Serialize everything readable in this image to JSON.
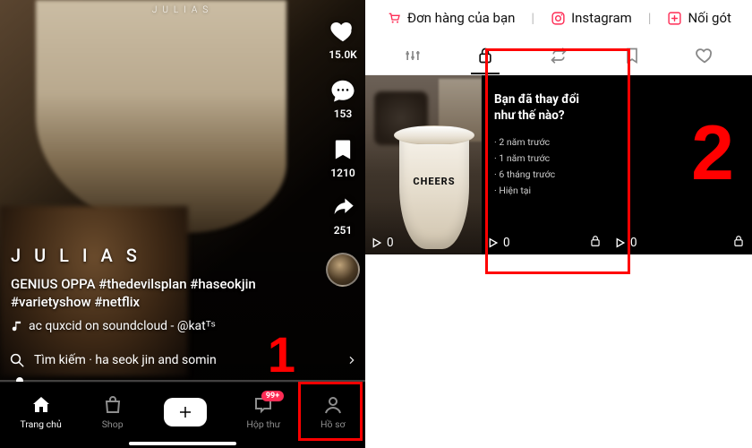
{
  "left": {
    "brand": "JULIAS",
    "rail": {
      "like_count": "15.0K",
      "comment_count": "153",
      "bookmark_count": "1210",
      "share_count": "251"
    },
    "username": "J U L I A S",
    "caption": "GENIUS OPPA #thedevilsplan #haseokjin #varietyshow #netflix",
    "sound": "ac quxcid on soundcloud - @katᵀˢ",
    "search_label": "Tìm kiếm · ha seok jin and somin",
    "nav": {
      "home": "Trang chủ",
      "shop": "Shop",
      "inbox": "Hộp thư",
      "inbox_badge": "99+",
      "profile": "Hồ sơ"
    },
    "annotation": "1"
  },
  "right": {
    "topbar": {
      "orders": "Đơn hàng của bạn",
      "instagram": "Instagram",
      "add": "Nối gót"
    },
    "grid": {
      "tile1": {
        "views": "0",
        "cup_brand": "CHEERS"
      },
      "tile2": {
        "title": "Bạn đã thay đổi như thế nào?",
        "lines": [
          "2 năm trước",
          "1 năm trước",
          "6 tháng trước",
          "Hiện tại"
        ],
        "views": "0"
      },
      "tile3": {
        "views": "0"
      }
    },
    "annotation": "2"
  }
}
